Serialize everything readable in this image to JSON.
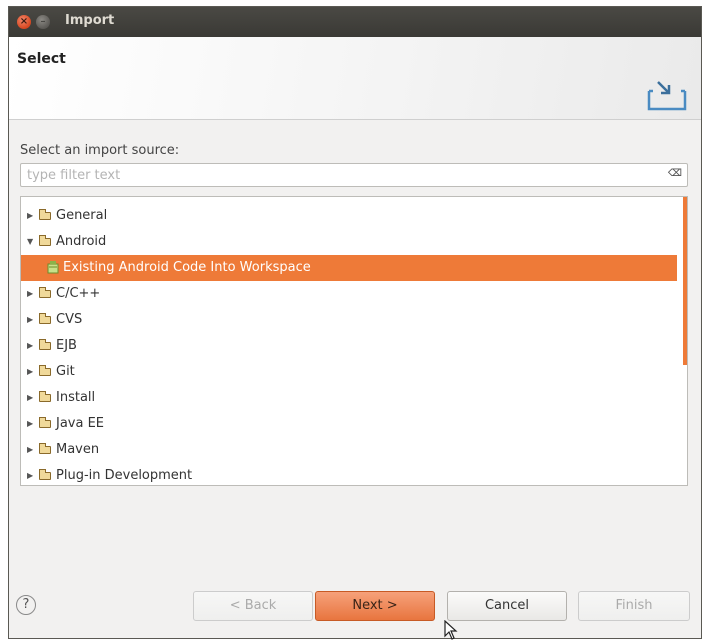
{
  "window": {
    "title": "Import"
  },
  "banner": {
    "title": "Select"
  },
  "source": {
    "label": "Select an import source:",
    "filter_placeholder": "type filter text"
  },
  "tree": [
    {
      "label": "General",
      "expanded": false,
      "depth": 0,
      "kind": "folder"
    },
    {
      "label": "Android",
      "expanded": true,
      "depth": 0,
      "kind": "folder"
    },
    {
      "label": "Existing Android Code Into Workspace",
      "depth": 1,
      "kind": "wizard",
      "selected": true
    },
    {
      "label": "C/C++",
      "expanded": false,
      "depth": 0,
      "kind": "folder"
    },
    {
      "label": "CVS",
      "expanded": false,
      "depth": 0,
      "kind": "folder"
    },
    {
      "label": "EJB",
      "expanded": false,
      "depth": 0,
      "kind": "folder"
    },
    {
      "label": "Git",
      "expanded": false,
      "depth": 0,
      "kind": "folder"
    },
    {
      "label": "Install",
      "expanded": false,
      "depth": 0,
      "kind": "folder"
    },
    {
      "label": "Java EE",
      "expanded": false,
      "depth": 0,
      "kind": "folder"
    },
    {
      "label": "Maven",
      "expanded": false,
      "depth": 0,
      "kind": "folder"
    },
    {
      "label": "Plug-in Development",
      "expanded": false,
      "depth": 0,
      "kind": "folder"
    }
  ],
  "buttons": {
    "help": "?",
    "back": "< Back",
    "next": "Next >",
    "cancel": "Cancel",
    "finish": "Finish"
  },
  "colors": {
    "accent": "#ee7a38",
    "titlebar": "#3c3b37"
  },
  "icons": {
    "window_close": "close-icon",
    "window_minimize": "minimize-icon",
    "banner": "import-icon",
    "filter_clear": "clear-filter-icon"
  }
}
